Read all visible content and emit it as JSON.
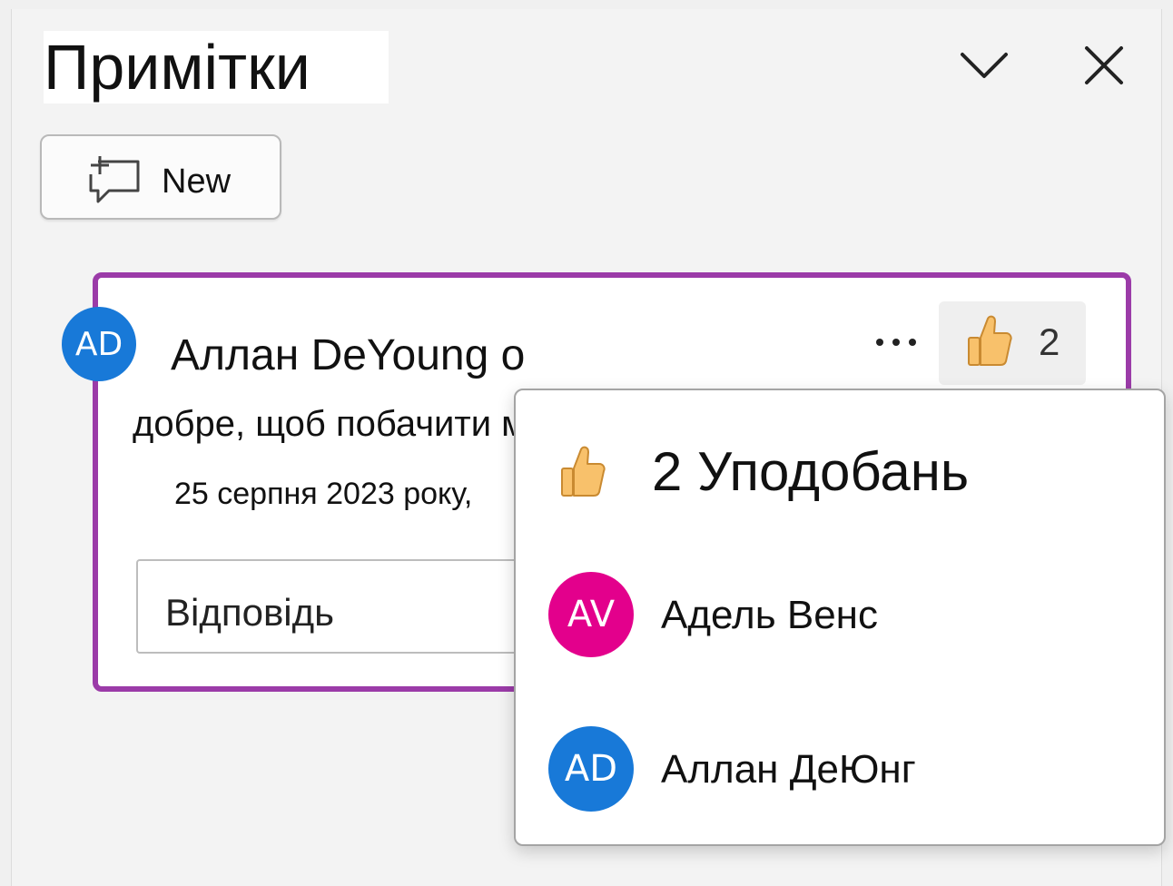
{
  "panel": {
    "title": "Примітки",
    "new_button_label": "New"
  },
  "comment": {
    "author_initials": "AD",
    "author_text": "Аллан DeYoung о",
    "body": "добре, щоб побачити ми",
    "date": "25 серпня 2023 року,",
    "like_count": "2",
    "reply_placeholder": "Відповідь"
  },
  "likes_popup": {
    "title": "2 Уподобань",
    "likers": [
      {
        "initials": "AV",
        "name": "Адель Венс",
        "color": "#e3008c"
      },
      {
        "initials": "AD",
        "name": "Аллан ДеЮнг",
        "color": "#1879d8"
      }
    ]
  },
  "colors": {
    "card_border": "#9b3ba8",
    "avatar_blue": "#1879d8",
    "avatar_magenta": "#e3008c",
    "thumb_fill": "#f8c16b"
  },
  "icons": {
    "collapse": "chevron-down-icon",
    "close": "close-icon",
    "new_comment": "new-comment-icon",
    "more": "more-options-icon",
    "like": "thumbs-up-icon"
  }
}
